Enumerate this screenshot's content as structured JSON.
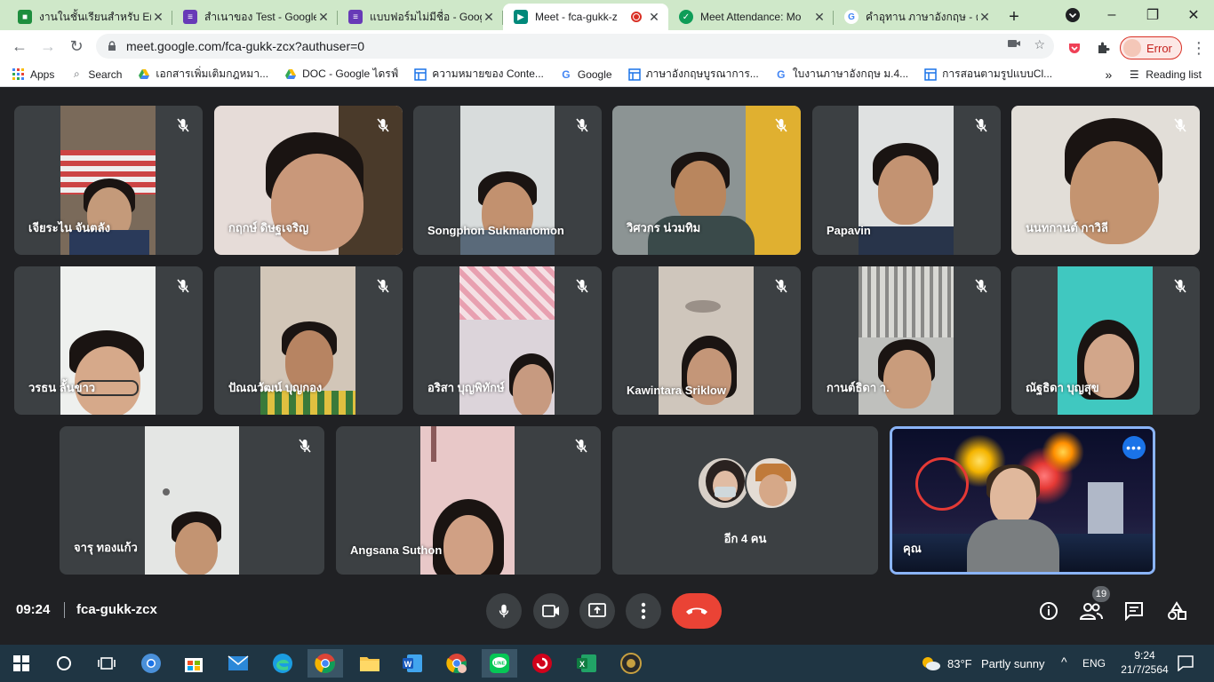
{
  "browser": {
    "tabs": [
      {
        "title": "งานในชั้นเรียนสำหรับ Eng",
        "icon": "classroom-icon",
        "color": "#1e8e3e"
      },
      {
        "title": "สำเนาของ Test - Google",
        "icon": "forms-icon",
        "color": "#673ab7"
      },
      {
        "title": "แบบฟอร์มไม่มีชื่อ - Goog",
        "icon": "forms-icon",
        "color": "#673ab7"
      },
      {
        "title": "Meet - fca-gukk-z",
        "icon": "meet-icon",
        "color": "#00897b",
        "active": true
      },
      {
        "title": "Meet Attendance: Mo",
        "icon": "attendance-icon",
        "color": "#0f9d58"
      },
      {
        "title": "คำอุทาน ภาษาอังกฤษ - ค้",
        "icon": "google-icon",
        "color": "#4285f4"
      }
    ],
    "address": "meet.google.com/fca-gukk-zcx?authuser=0",
    "profile_status": "Error",
    "bookmarks": [
      {
        "label": "Apps",
        "icon": "apps-grid-icon"
      },
      {
        "label": "Search",
        "icon": "search-icon"
      },
      {
        "label": "เอกสารเพิ่มเติมกฎหมา...",
        "icon": "drive-icon"
      },
      {
        "label": "DOC - Google ไดรฟ์",
        "icon": "drive-icon"
      },
      {
        "label": "ความหมายของ Conte...",
        "icon": "page-icon"
      },
      {
        "label": "Google",
        "icon": "google-icon"
      },
      {
        "label": "ภาษาอังกฤษบูรณาการ...",
        "icon": "page-icon"
      },
      {
        "label": "ใบงานภาษาอังกฤษ ม.4...",
        "icon": "google-icon"
      },
      {
        "label": "การสอนตามรูปแบบCl...",
        "icon": "page-icon"
      }
    ],
    "overflow_label": "»",
    "reading_list": "Reading list"
  },
  "meet": {
    "participants": [
      {
        "name": "เจียระไน จันตลัง",
        "muted": true
      },
      {
        "name": "กฤกษ์ ดิษฐเจริญ",
        "muted": true
      },
      {
        "name": "Songphon Sukmanomon",
        "muted": true
      },
      {
        "name": "วิศวกร น่วมทิม",
        "muted": true
      },
      {
        "name": "Papavin",
        "muted": true
      },
      {
        "name": "นนทกานต์ กาวิลี",
        "muted": true
      },
      {
        "name": "วรธน ลั้นขาว",
        "muted": true
      },
      {
        "name": "ปัณณวัฒน์ บุญกอง",
        "muted": true
      },
      {
        "name": "อริสา บุญพิทักษ์",
        "muted": true
      },
      {
        "name": "Kawintara Sriklow",
        "muted": true
      },
      {
        "name": "กานต์ธิดา า.",
        "muted": true
      },
      {
        "name": "ณัฐธิดา บุญสุข",
        "muted": true
      },
      {
        "name": "จารุ ทองแก้ว",
        "muted": true
      },
      {
        "name": "Angsana Suthon",
        "muted": true
      }
    ],
    "others_label": "อีก 4 คน",
    "self_label": "คุณ",
    "time": "09:24",
    "meeting_code": "fca-gukk-zcx",
    "people_count": "19"
  },
  "taskbar": {
    "weather_temp": "83°F",
    "weather_text": "Partly sunny",
    "language": "ENG",
    "time": "9:24",
    "date": "21/7/2564"
  }
}
